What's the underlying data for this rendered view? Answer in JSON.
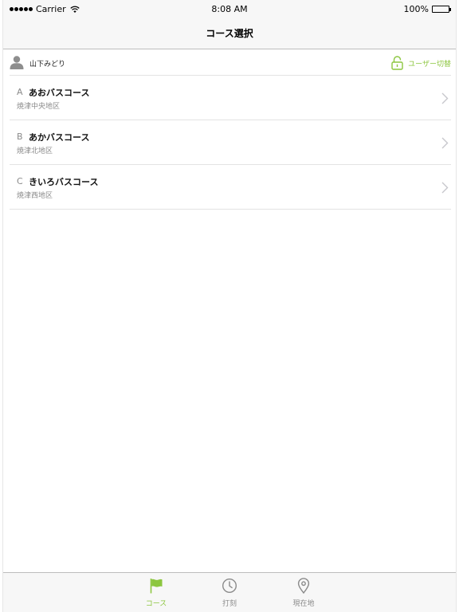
{
  "status_bar": {
    "carrier": "Carrier",
    "time": "8:08 AM",
    "battery": "100%"
  },
  "nav": {
    "title": "コース選択"
  },
  "user": {
    "name": "山下みどり",
    "switch_label": "ユーザー切替"
  },
  "courses": [
    {
      "letter": "A",
      "name": "あおバスコース",
      "area": "焼津中央地区"
    },
    {
      "letter": "B",
      "name": "あかバスコース",
      "area": "焼津北地区"
    },
    {
      "letter": "C",
      "name": "きいろバスコース",
      "area": "焼津西地区"
    }
  ],
  "tabs": [
    {
      "label": "コース",
      "icon": "flag-icon",
      "active": true
    },
    {
      "label": "打刻",
      "icon": "clock-icon",
      "active": false
    },
    {
      "label": "現在地",
      "icon": "location-pin-icon",
      "active": false
    }
  ],
  "colors": {
    "accent": "#8cc63f",
    "secondary_text": "#8a8a8a",
    "bar_background": "#f7f7f7"
  }
}
